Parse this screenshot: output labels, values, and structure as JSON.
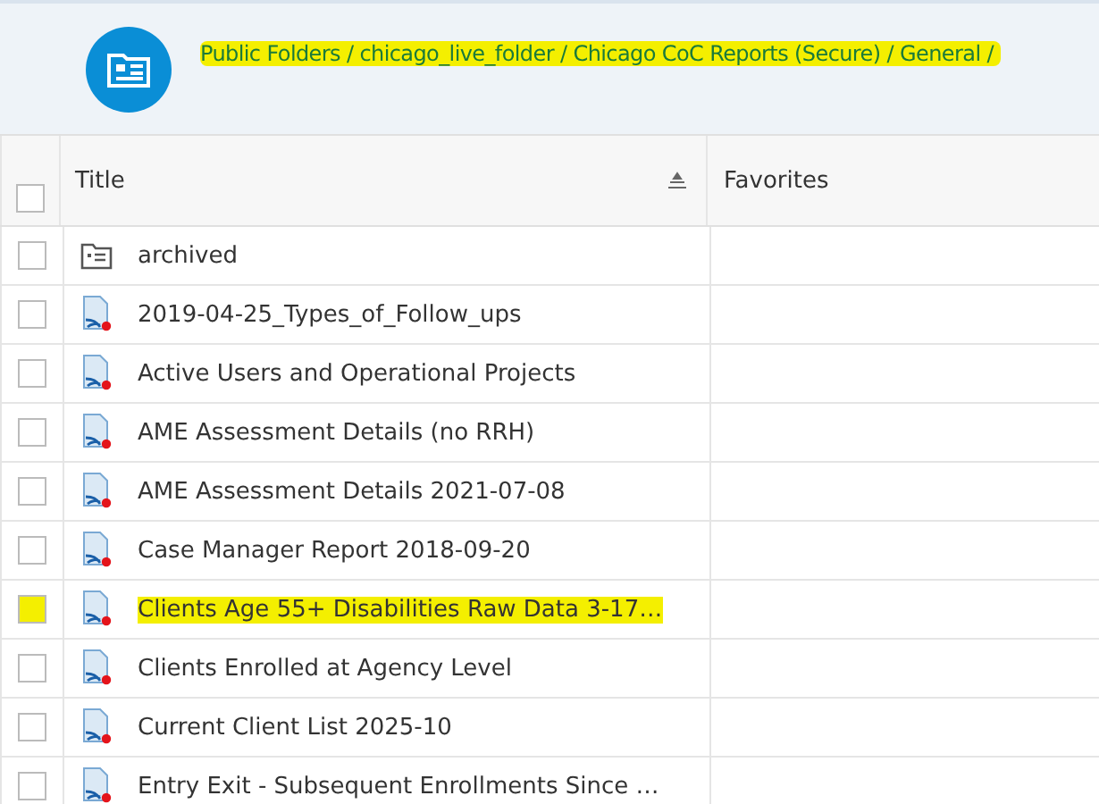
{
  "breadcrumb": {
    "text": "Public Folders / chicago_live_folder / Chicago CoC Reports (Secure) / General /",
    "highlighted": true
  },
  "table": {
    "columns": [
      "Title",
      "Favorites"
    ],
    "all_checked": false,
    "rows": [
      {
        "kind": "folder",
        "title": "archived",
        "checked": false,
        "highlighted": false
      },
      {
        "kind": "report",
        "title": "2019-04-25_Types_of_Follow_ups",
        "checked": false,
        "highlighted": false
      },
      {
        "kind": "report",
        "title": "Active Users and Operational Projects",
        "checked": false,
        "highlighted": false
      },
      {
        "kind": "report",
        "title": "AME Assessment Details (no RRH)",
        "checked": false,
        "highlighted": false
      },
      {
        "kind": "report",
        "title": "AME Assessment Details 2021-07-08",
        "checked": false,
        "highlighted": false
      },
      {
        "kind": "report",
        "title": "Case Manager Report 2018-09-20",
        "checked": false,
        "highlighted": false
      },
      {
        "kind": "report",
        "title": "Clients Age 55+ Disabilities Raw Data 3-17…",
        "checked": false,
        "highlighted": true
      },
      {
        "kind": "report",
        "title": "Clients Enrolled at Agency Level",
        "checked": false,
        "highlighted": false
      },
      {
        "kind": "report",
        "title": "Current Client List 2025-10",
        "checked": false,
        "highlighted": false
      },
      {
        "kind": "report",
        "title": "Entry Exit - Subsequent Enrollments Since …",
        "checked": false,
        "highlighted": false
      }
    ]
  }
}
